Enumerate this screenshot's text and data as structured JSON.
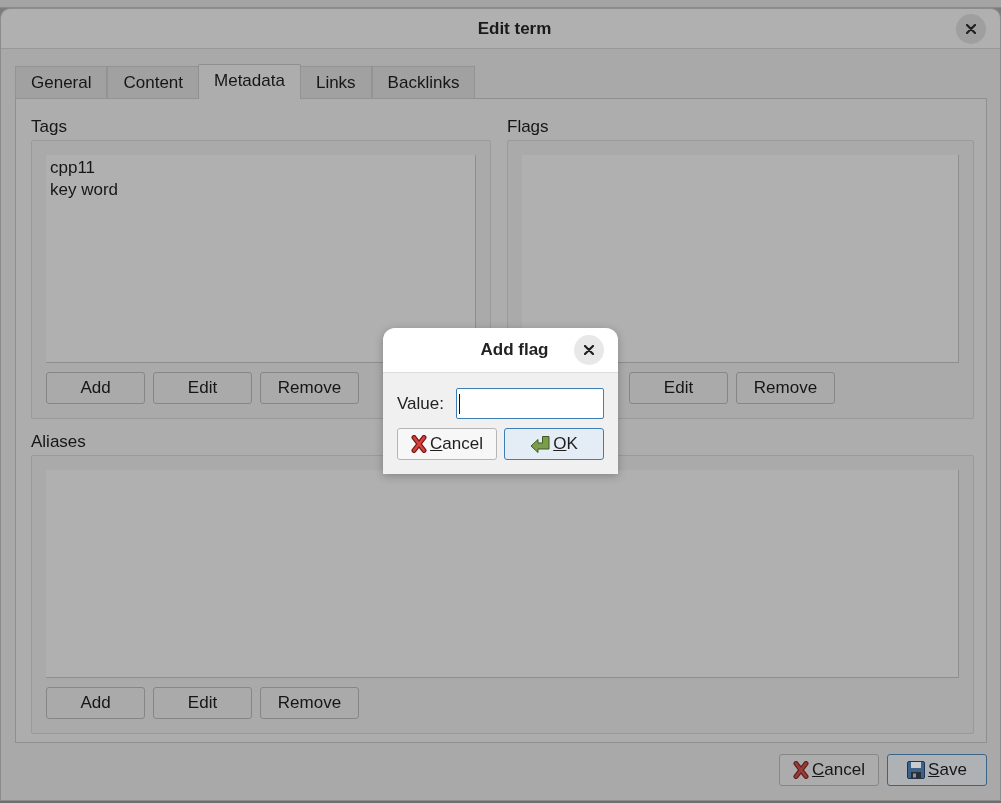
{
  "window": {
    "title": "Edit term"
  },
  "tabs": [
    {
      "label": "General",
      "selected": false
    },
    {
      "label": "Content",
      "selected": false
    },
    {
      "label": "Metadata",
      "selected": true
    },
    {
      "label": "Links",
      "selected": false
    },
    {
      "label": "Backlinks",
      "selected": false
    }
  ],
  "tags": {
    "label": "Tags",
    "items": [
      "cpp11",
      "key word"
    ],
    "buttons": [
      "Add",
      "Edit",
      "Remove"
    ]
  },
  "flags": {
    "label": "Flags",
    "buttons": [
      "Edit",
      "Remove"
    ]
  },
  "aliases": {
    "label": "Aliases",
    "buttons": [
      "Add",
      "Edit",
      "Remove"
    ]
  },
  "buttons": [
    {
      "label": "Cancel",
      "kind": "cancel",
      "default": false
    },
    {
      "label": "Save",
      "kind": "save",
      "default": true
    }
  ],
  "add_flag_dialog": {
    "title": "Add flag",
    "field": {
      "label": "Value:",
      "focused": true
    },
    "buttons": [
      {
        "label": "Cancel",
        "kind": "cancel",
        "default": false
      },
      {
        "label": "OK",
        "kind": "ok",
        "default": true
      }
    ]
  }
}
